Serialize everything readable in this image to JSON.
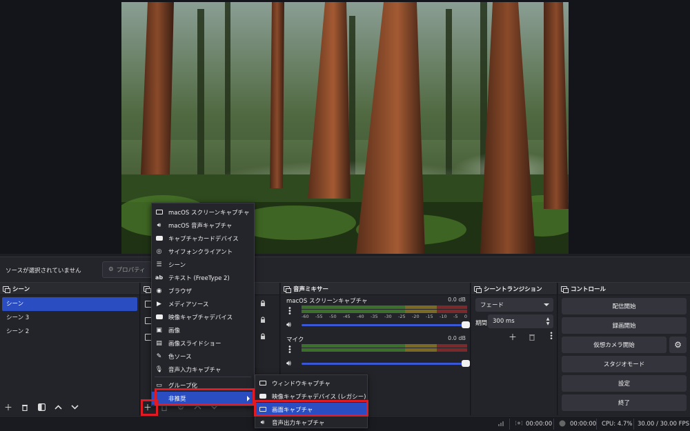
{
  "context": {
    "no_source": "ソースが選択されていません",
    "properties": "プロパティ"
  },
  "scenes": {
    "title": "シーン",
    "items": [
      "シーン",
      "シーン 3",
      "シーン 2"
    ]
  },
  "mixer": {
    "title": "音声ミキサー",
    "scale": [
      "-60",
      "-55",
      "-50",
      "-45",
      "-40",
      "-35",
      "-30",
      "-25",
      "-20",
      "-15",
      "-10",
      "-5",
      "0"
    ],
    "channels": [
      {
        "name": "macOS スクリーンキャプチャ",
        "db": "0.0 dB"
      },
      {
        "name": "マイク",
        "db": "0.0 dB"
      }
    ]
  },
  "transitions": {
    "title": "シーントランジション",
    "selected": "フェード",
    "duration_label": "期間",
    "duration": "300 ms"
  },
  "controls": {
    "title": "コントロール",
    "start_stream": "配信開始",
    "start_record": "録画開始",
    "start_virtualcam": "仮想カメラ開始",
    "studio_mode": "スタジオモード",
    "settings": "設定",
    "exit": "終了"
  },
  "status": {
    "stream_time": "00:00:00",
    "record_time": "00:00:00",
    "cpu": "CPU: 4.7%",
    "fps": "30.00 / 30.00 FPS"
  },
  "add_menu": {
    "items": [
      {
        "label": "macOS スクリーンキャプチャ",
        "icon": "monitor-icon"
      },
      {
        "label": "macOS 音声キャプチャ",
        "icon": "speaker-icon"
      },
      {
        "label": "キャプチャカードデバイス",
        "icon": "camera-icon"
      },
      {
        "label": "サイフォンクライアント",
        "icon": "gamepad-icon"
      },
      {
        "label": "シーン",
        "icon": "list-icon"
      },
      {
        "label": "テキスト (FreeType 2)",
        "icon": "text-icon"
      },
      {
        "label": "ブラウザ",
        "icon": "globe-icon"
      },
      {
        "label": "メディアソース",
        "icon": "play-icon"
      },
      {
        "label": "映像キャプチャデバイス",
        "icon": "camera-icon"
      },
      {
        "label": "画像",
        "icon": "image-icon"
      },
      {
        "label": "画像スライドショー",
        "icon": "slideshow-icon"
      },
      {
        "label": "色ソース",
        "icon": "brush-icon"
      },
      {
        "label": "音声入力キャプチャ",
        "icon": "mic-icon"
      }
    ],
    "group": "グループ化",
    "deprecated": "非推奨"
  },
  "deprecated_menu": {
    "items": [
      {
        "label": "ウィンドウキャプチャ",
        "icon": "window-icon"
      },
      {
        "label": "映像キャプチャデバイス (レガシー)",
        "icon": "camera-icon"
      },
      {
        "label": "画面キャプチャ",
        "icon": "monitor-icon"
      },
      {
        "label": "音声出力キャプチャ",
        "icon": "speaker-icon"
      }
    ]
  }
}
